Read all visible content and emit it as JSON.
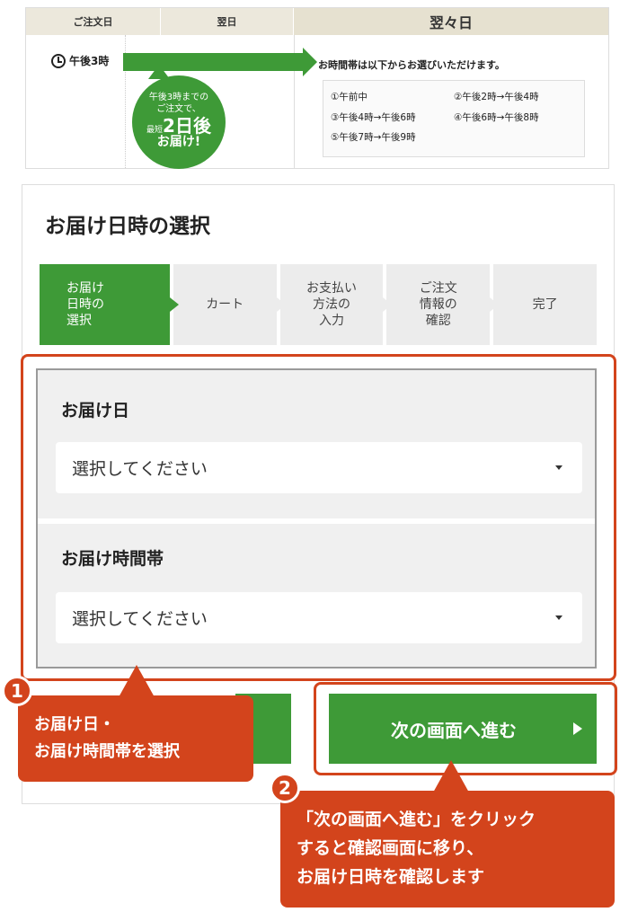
{
  "timeline": {
    "col1_header": "ご注文日",
    "col2_header": "翌日",
    "col3_header": "翌々日",
    "order_time": "午後3時",
    "bubble": {
      "line1": "午後3時までの",
      "line2": "ご注文で、",
      "prefix": "最短",
      "big": "2日後",
      "line4": "お届け!"
    },
    "slot_title": "お時間帯は以下からお選びいただけます。",
    "slots": [
      "①午前中",
      "②午後2時→午後4時",
      "③午後4時→午後6時",
      "④午後6時→午後8時",
      "⑤午後7時→午後9時"
    ]
  },
  "page_title": "お届け日時の選択",
  "steps": [
    {
      "label": "お届け\n日時の\n選択",
      "active": true
    },
    {
      "label": "カート",
      "active": false
    },
    {
      "label": "お支払い\n方法の\n入力",
      "active": false
    },
    {
      "label": "ご注文\n情報の\n確認",
      "active": false
    },
    {
      "label": "完了",
      "active": false
    }
  ],
  "form": {
    "date_label": "お届け日",
    "date_placeholder": "選択してください",
    "time_label": "お届け時間帯",
    "time_placeholder": "選択してください"
  },
  "next_button": "次の画面へ進む",
  "callouts": {
    "num1": "1",
    "text1": "お届け日・\nお届け時間帯を選択",
    "num2": "2",
    "text2": "「次の画面へ進む」をクリック\nすると確認画面に移り、\nお届け日時を確認します"
  },
  "colors": {
    "green": "#3e9a37",
    "callout_red": "#d3441c",
    "step_gray": "#ececec"
  }
}
